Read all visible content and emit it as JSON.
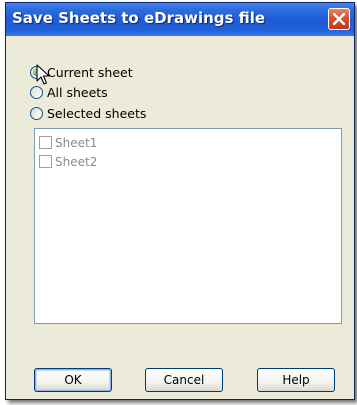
{
  "window": {
    "title": "Save Sheets to eDrawings file"
  },
  "options": [
    {
      "label": "Current sheet",
      "checked": true
    },
    {
      "label": "All sheets",
      "checked": false
    },
    {
      "label": "Selected sheets",
      "checked": false
    }
  ],
  "sheets": [
    {
      "label": "Sheet1",
      "checked": false
    },
    {
      "label": "Sheet2",
      "checked": false
    }
  ],
  "buttons": {
    "ok": "OK",
    "cancel": "Cancel",
    "help": "Help"
  },
  "colors": {
    "titlebar": "#1f5cd6",
    "dialog_bg": "#ecead8",
    "close_button": "#d5532f",
    "radio_checked": "#2aa52a",
    "list_border": "#7f9db9",
    "button_border": "#003c74"
  },
  "icons": {
    "close": "close-icon",
    "cursor": "mouse-pointer-icon"
  }
}
